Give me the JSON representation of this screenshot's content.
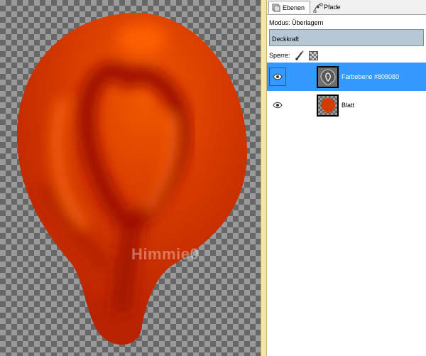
{
  "canvas": {
    "watermark": "Himmie0"
  },
  "panel": {
    "tabs": [
      {
        "label": "Ebenen",
        "icon": "layers-icon"
      },
      {
        "label": "Pfade",
        "icon": "paths-icon"
      }
    ],
    "mode_label": "Modus: Überlagern",
    "opacity_label": "Deckkraft",
    "lock_label": "Sperre:",
    "layers": [
      {
        "name": "Farbebene #808080",
        "selected": true,
        "thumbnail": "gray-leaf-emboss"
      },
      {
        "name": "Blatt",
        "selected": false,
        "thumbnail": "red-leaf"
      }
    ]
  },
  "colors": {
    "leaf_bright": "#e84a00",
    "leaf_dark": "#a80f00",
    "selection": "#3399ff",
    "divider": "#f1e7a6"
  }
}
